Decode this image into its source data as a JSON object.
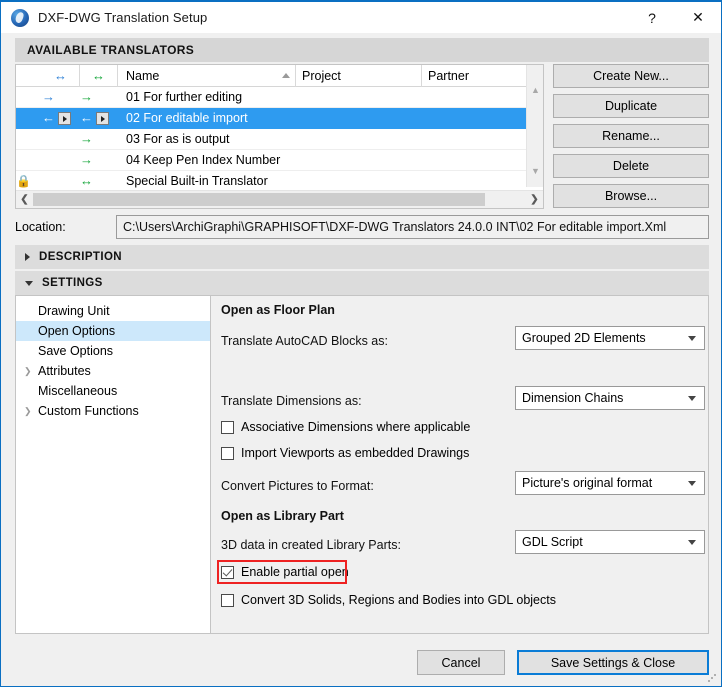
{
  "window": {
    "title": "DXF-DWG Translation Setup",
    "icon": "graphisoft-app-icon",
    "help_label": "?",
    "close_label": "✕",
    "accent_color": "#0a6fc2",
    "selection_color": "#2e9bf0",
    "tree_selection_color": "#cde8fb",
    "highlight_color": "#ee2222"
  },
  "available_translators": {
    "section_label": "AVAILABLE TRANSLATORS",
    "columns": [
      {
        "key": "lock",
        "label": ""
      },
      {
        "key": "import",
        "label": "↔"
      },
      {
        "key": "export",
        "label": "↔"
      },
      {
        "key": "name",
        "label": "Name",
        "sorted": "asc"
      },
      {
        "key": "project",
        "label": "Project"
      },
      {
        "key": "partner",
        "label": "Partner"
      }
    ],
    "rows": [
      {
        "lock": "",
        "import_icon": "arrow-right-blue",
        "import_btn": false,
        "export_icon": "arrow-right-green",
        "export_btn": false,
        "name": "01 For further editing",
        "project": "",
        "partner": "",
        "selected": false
      },
      {
        "lock": "",
        "import_icon": "arrow-left-blue",
        "import_btn": true,
        "export_icon": "arrow-left-green",
        "export_btn": true,
        "name": "02 For editable import",
        "project": "",
        "partner": "",
        "selected": true
      },
      {
        "lock": "",
        "import_icon": "",
        "import_btn": false,
        "export_icon": "arrow-right-green",
        "export_btn": false,
        "name": "03 For as is output",
        "project": "",
        "partner": "",
        "selected": false
      },
      {
        "lock": "",
        "import_icon": "",
        "import_btn": false,
        "export_icon": "arrow-right-green",
        "export_btn": false,
        "name": "04 Keep Pen Index Number",
        "project": "",
        "partner": "",
        "selected": false
      },
      {
        "lock": "lock-icon",
        "import_icon": "",
        "import_btn": false,
        "export_icon": "arrow-both-green",
        "export_btn": false,
        "name": "Special Built-in Translator",
        "project": "",
        "partner": "",
        "selected": false
      }
    ],
    "buttons": [
      {
        "label": "Create New..."
      },
      {
        "label": "Duplicate"
      },
      {
        "label": "Rename..."
      },
      {
        "label": "Delete"
      },
      {
        "label": "Browse..."
      }
    ]
  },
  "location": {
    "label": "Location:",
    "value": "C:\\Users\\ArchiGraphi\\GRAPHISOFT\\DXF-DWG Translators 24.0.0 INT\\02 For editable import.Xml"
  },
  "panels": {
    "description": {
      "label": "DESCRIPTION",
      "expanded": false
    },
    "settings": {
      "label": "SETTINGS",
      "expanded": true
    }
  },
  "settings_tree": {
    "items": [
      {
        "label": "Drawing Unit",
        "expandable": false,
        "selected": false
      },
      {
        "label": "Open Options",
        "expandable": false,
        "selected": true
      },
      {
        "label": "Save Options",
        "expandable": false,
        "selected": false
      },
      {
        "label": "Attributes",
        "expandable": true,
        "selected": false
      },
      {
        "label": "Miscellaneous",
        "expandable": false,
        "selected": false
      },
      {
        "label": "Custom Functions",
        "expandable": true,
        "selected": false
      }
    ]
  },
  "open_options": {
    "group_floor_plan": "Open as Floor Plan",
    "translate_blocks_label": "Translate AutoCAD Blocks as:",
    "translate_blocks_value": "Grouped 2D Elements",
    "translate_dimensions_label": "Translate Dimensions as:",
    "translate_dimensions_value": "Dimension Chains",
    "associative_dimensions_label": "Associative Dimensions where applicable",
    "associative_dimensions_checked": false,
    "import_viewports_label": "Import Viewports as embedded Drawings",
    "import_viewports_checked": false,
    "convert_pictures_label": "Convert Pictures to Format:",
    "convert_pictures_value": "Picture's original format",
    "group_library_part": "Open as Library Part",
    "library_3d_data_label": "3D data in created Library Parts:",
    "library_3d_data_value": "GDL Script",
    "enable_partial_open_label": "Enable partial open",
    "enable_partial_open_checked": true,
    "enable_partial_open_highlighted": true,
    "convert_solids_label": "Convert 3D Solids, Regions and Bodies into GDL objects",
    "convert_solids_checked": false
  },
  "footer": {
    "cancel_label": "Cancel",
    "save_label": "Save Settings & Close"
  }
}
